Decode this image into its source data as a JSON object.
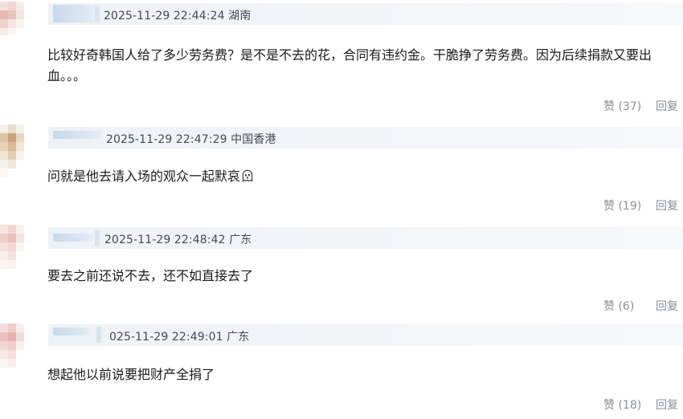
{
  "comments": [
    {
      "timestamp": "2025-11-29 22:44:24",
      "location": "湖南",
      "text": "比较好奇韩国人给了多少劳务费？是不是不去的花，合同有违约金。干脆挣了劳务费。因为后续捐款又要出血。。。",
      "like_label": "赞",
      "like_count": "(37)",
      "reply_label": "回复"
    },
    {
      "timestamp": "2025-11-29 22:47:29",
      "location": "中国香港",
      "text": "问就是他去请入场的观众一起默哀",
      "emoji": "ghost-icon",
      "like_label": "赞",
      "like_count": "(19)",
      "reply_label": "回复"
    },
    {
      "timestamp": "2025-11-29 22:48:42",
      "location": "广东",
      "text": "要去之前还说不去，还不如直接去了",
      "like_label": "赞",
      "like_count": "(6)",
      "reply_label": "回复"
    },
    {
      "timestamp": "025-11-29 22:49:01",
      "location": "广东",
      "text": "想起他以前说要把财产全捐了",
      "like_label": "赞",
      "like_count": "(18)",
      "reply_label": "回复"
    }
  ]
}
